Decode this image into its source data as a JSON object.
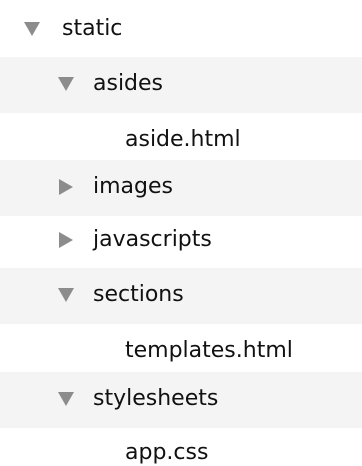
{
  "file_tree": {
    "items": [
      {
        "label": "static",
        "expanded": true,
        "has_children": true,
        "depth": 0
      },
      {
        "label": "asides",
        "expanded": true,
        "has_children": true,
        "depth": 1
      },
      {
        "label": "aside.html",
        "has_children": false,
        "depth": 2
      },
      {
        "label": "images",
        "expanded": false,
        "has_children": true,
        "depth": 1
      },
      {
        "label": "javascripts",
        "expanded": false,
        "has_children": true,
        "depth": 1
      },
      {
        "label": "sections",
        "expanded": true,
        "has_children": true,
        "depth": 1
      },
      {
        "label": "templates.html",
        "has_children": false,
        "depth": 2
      },
      {
        "label": "stylesheets",
        "expanded": true,
        "has_children": true,
        "depth": 1
      },
      {
        "label": "app.css",
        "has_children": false,
        "depth": 2
      }
    ]
  },
  "colors": {
    "disclosure_triangle": "#8c8c8c",
    "alt_row_background": "#f4f4f4",
    "text": "#111111"
  }
}
